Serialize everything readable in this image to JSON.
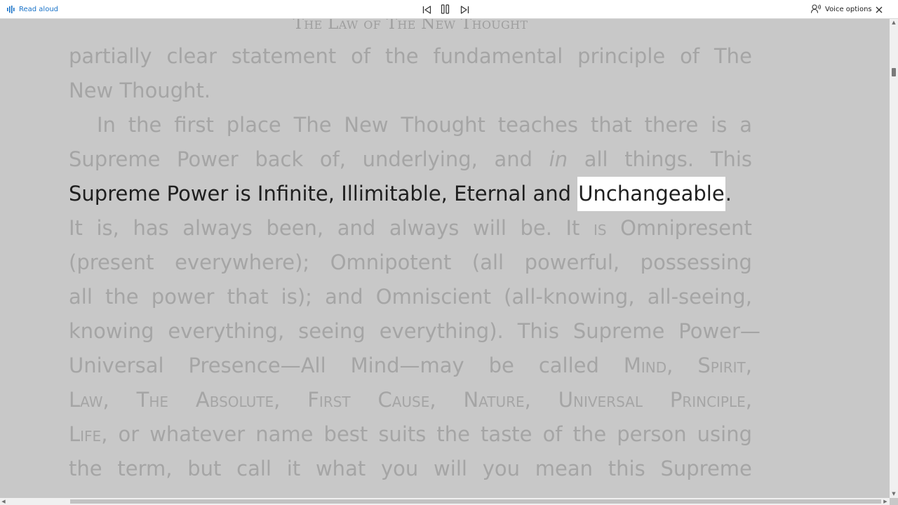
{
  "toolbar": {
    "read_aloud_label": "Read aloud",
    "voice_options_label": "Voice options",
    "accent_color": "#1a73c8"
  },
  "icons": {
    "read_aloud": "audio-waveform-icon",
    "previous": "skip-previous-icon",
    "pause": "pause-icon",
    "next": "skip-next-icon",
    "voice_options": "voice-settings-icon",
    "close": "close-icon"
  },
  "book": {
    "running_head": "The Law of The New Thought",
    "highlighted_word": "Unchangeable",
    "lines": [
      "partially clear statement of the fundamental principle of The",
      "New Thought.",
      "In the first place The New Thought teaches that there is a",
      "Supreme Power back of, underlying, and in all things. This",
      "Supreme Power is Infinite, Illimitable, Eternal and",
      "It is, has always been, and always will be. It is Omnipresent",
      "(present everywhere); Omnipotent (all powerful, possessing",
      "all the power that is); and Omniscient (all-knowing, all-seeing,",
      "knowing everything, seeing everything). This Supreme Power—",
      "Universal Presence—All Mind—may be called Mind, Spirit,",
      "Law, The Absolute, First Cause, Nature, Universal Principle,",
      "Life, or whatever name best suits the taste of the person using",
      "the term, but call it what you will you mean this Supreme"
    ]
  }
}
